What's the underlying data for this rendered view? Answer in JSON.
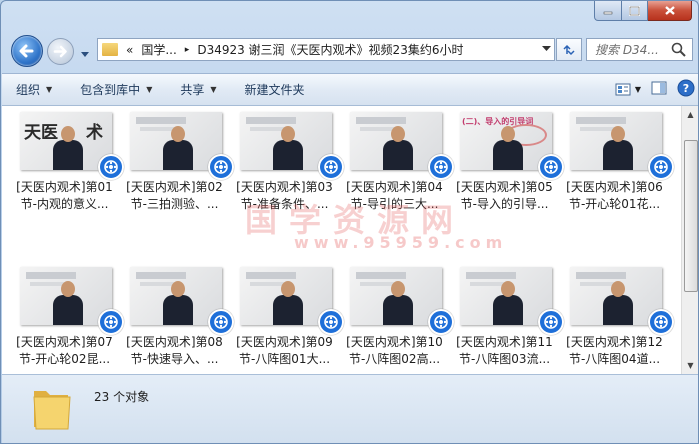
{
  "window": {
    "minimize_label": "minimize",
    "maximize_label": "maximize",
    "close_label": "close"
  },
  "address": {
    "chevrons": "«",
    "crumb1": "国学...",
    "sep": "▸",
    "crumb2": "D34923 谢三润《天医内观术》视频23集约6小时"
  },
  "search": {
    "placeholder": "搜索 D34..."
  },
  "toolbar": {
    "organize": "组织",
    "include_library": "包含到库中",
    "share": "共享",
    "new_folder": "新建文件夹"
  },
  "files": [
    {
      "line1": "[天医内观术]第01",
      "line2": "节-内观的意义..."
    },
    {
      "line1": "[天医内观术]第02",
      "line2": "节-三拍测验、..."
    },
    {
      "line1": "[天医内观术]第03",
      "line2": "节-准备条件、..."
    },
    {
      "line1": "[天医内观术]第04",
      "line2": "节-导引的三大..."
    },
    {
      "line1": "[天医内观术]第05",
      "line2": "节-导入的引导..."
    },
    {
      "line1": "[天医内观术]第06",
      "line2": "节-开心轮01花..."
    },
    {
      "line1": "[天医内观术]第07",
      "line2": "节-开心轮02昆..."
    },
    {
      "line1": "[天医内观术]第08",
      "line2": "节-快速导入、..."
    },
    {
      "line1": "[天医内观术]第09",
      "line2": "节-八阵图01大..."
    },
    {
      "line1": "[天医内观术]第10",
      "line2": "节-八阵图02高..."
    },
    {
      "line1": "[天医内观术]第11",
      "line2": "节-八阵图03流..."
    },
    {
      "line1": "[天医内观术]第12",
      "line2": "节-八阵图04道..."
    }
  ],
  "thumb_texts": {
    "first_calligraphy": "天医",
    "first_calligraphy2": "术",
    "fifth_caption": "(二)、导入的引导词"
  },
  "watermark": {
    "line1": "国学资源网",
    "line2": "www.95959.com"
  },
  "status": {
    "count": "23 个对象"
  },
  "colors": {
    "accent": "#1e6fd9",
    "toolbar_text": "#1e395b"
  }
}
